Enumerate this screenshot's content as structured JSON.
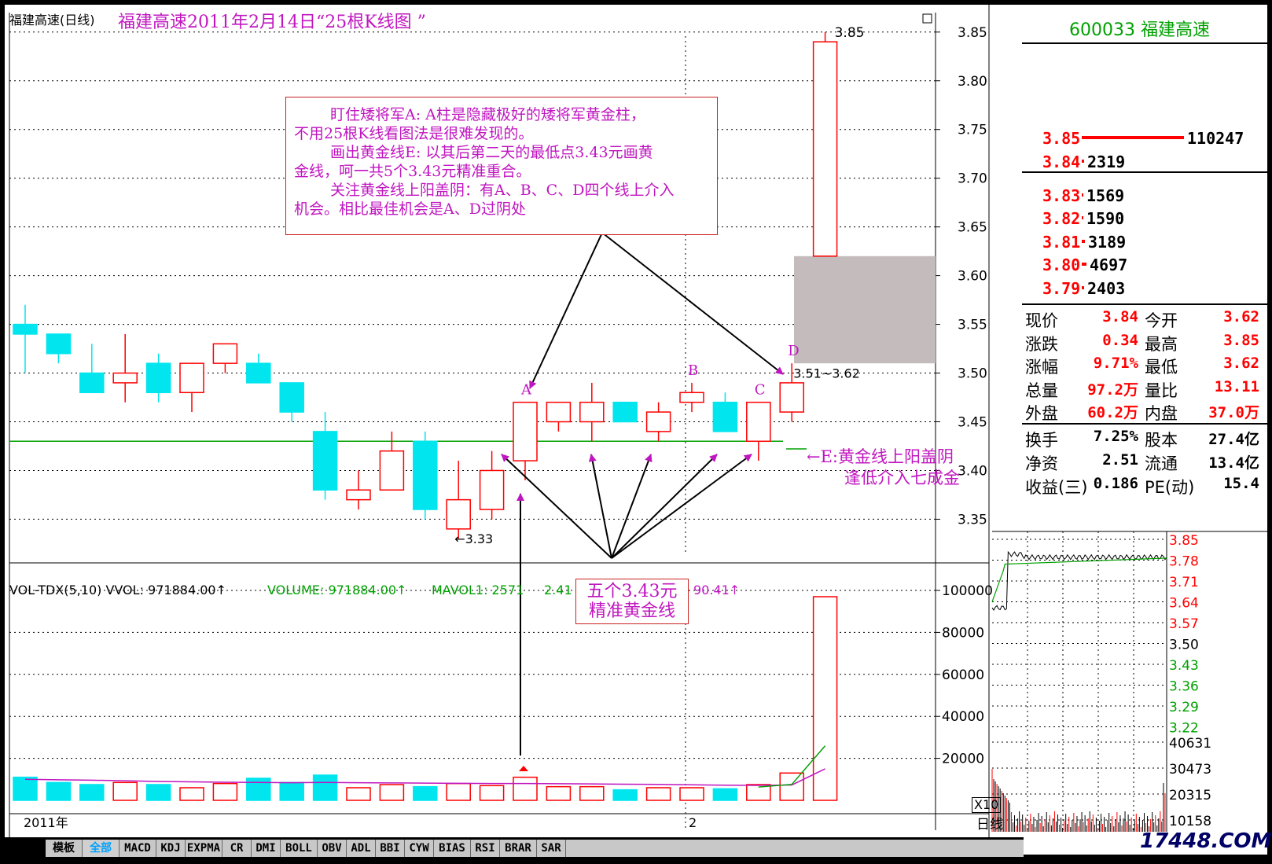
{
  "header": {
    "stock_label": "福建高速(日线)",
    "title": "福建高速2011年2月14日“25根K线图 ”"
  },
  "chart_data": [
    {
      "type": "candlestick",
      "name": "25根K线",
      "ylim": [
        3.31,
        3.87
      ],
      "yticks": [
        "3.85",
        "3.80",
        "3.75",
        "3.70",
        "3.65",
        "3.60",
        "3.55",
        "3.50",
        "3.45",
        "3.40",
        "3.35"
      ],
      "candles": [
        {
          "o": 3.55,
          "c": 3.54,
          "h": 3.57,
          "l": 3.5
        },
        {
          "o": 3.54,
          "c": 3.52,
          "h": 3.54,
          "l": 3.51
        },
        {
          "o": 3.5,
          "c": 3.48,
          "h": 3.53,
          "l": 3.48
        },
        {
          "o": 3.49,
          "c": 3.5,
          "h": 3.54,
          "l": 3.47
        },
        {
          "o": 3.51,
          "c": 3.48,
          "h": 3.52,
          "l": 3.47
        },
        {
          "o": 3.48,
          "c": 3.51,
          "h": 3.51,
          "l": 3.46
        },
        {
          "o": 3.51,
          "c": 3.53,
          "h": 3.53,
          "l": 3.5
        },
        {
          "o": 3.51,
          "c": 3.49,
          "h": 3.52,
          "l": 3.49
        },
        {
          "o": 3.49,
          "c": 3.46,
          "h": 3.49,
          "l": 3.45
        },
        {
          "o": 3.44,
          "c": 3.38,
          "h": 3.46,
          "l": 3.37
        },
        {
          "o": 3.37,
          "c": 3.38,
          "h": 3.4,
          "l": 3.36
        },
        {
          "o": 3.38,
          "c": 3.42,
          "h": 3.44,
          "l": 3.38
        },
        {
          "o": 3.43,
          "c": 3.36,
          "h": 3.44,
          "l": 3.35
        },
        {
          "o": 3.34,
          "c": 3.37,
          "h": 3.41,
          "l": 3.33
        },
        {
          "o": 3.36,
          "c": 3.4,
          "h": 3.42,
          "l": 3.35
        },
        {
          "o": 3.41,
          "c": 3.47,
          "h": 3.47,
          "l": 3.39
        },
        {
          "o": 3.45,
          "c": 3.47,
          "h": 3.47,
          "l": 3.44
        },
        {
          "o": 3.45,
          "c": 3.47,
          "h": 3.49,
          "l": 3.43
        },
        {
          "o": 3.47,
          "c": 3.45,
          "h": 3.47,
          "l": 3.45
        },
        {
          "o": 3.44,
          "c": 3.46,
          "h": 3.47,
          "l": 3.43
        },
        {
          "o": 3.47,
          "c": 3.48,
          "h": 3.49,
          "l": 3.46
        },
        {
          "o": 3.47,
          "c": 3.44,
          "h": 3.48,
          "l": 3.44
        },
        {
          "o": 3.43,
          "c": 3.47,
          "h": 3.47,
          "l": 3.41
        },
        {
          "o": 3.46,
          "c": 3.49,
          "h": 3.51,
          "l": 3.45
        },
        {
          "o": 3.62,
          "c": 3.84,
          "h": 3.85,
          "l": 3.62
        }
      ],
      "points": {
        "A": 15,
        "B": 20,
        "C": 22,
        "D": 23
      },
      "golden_line": 3.43,
      "high_label": "3.85",
      "low_label": "←3.33",
      "range_label": "3.51~3.62",
      "gap_range": [
        3.51,
        3.62
      ],
      "golden_label_1": "←E:黄金线上阳盖阴",
      "golden_label_2": "逢低介入七成金"
    },
    {
      "type": "bar",
      "name": "VOL-TDX(5,10)",
      "ylim": [
        0,
        100000
      ],
      "yticks": [
        "100000",
        "80000",
        "60000",
        "40000",
        "20000"
      ],
      "values": [
        11000,
        8500,
        7500,
        8500,
        7500,
        6000,
        8000,
        10500,
        8500,
        12000,
        6000,
        7500,
        6500,
        8000,
        7000,
        11000,
        6500,
        6500,
        5000,
        6000,
        6000,
        5500,
        7500,
        13000,
        97000
      ],
      "ma5": [
        10500,
        10000,
        9500,
        9000,
        8800,
        8200,
        8000,
        8100,
        8200,
        8800,
        9000,
        8800,
        8500,
        8200,
        7800,
        8000,
        7900,
        7800,
        7300,
        7000,
        6500,
        6000,
        6300,
        7600,
        26000
      ],
      "ma10": [
        10000,
        9800,
        9600,
        9300,
        9000,
        8800,
        8600,
        8500,
        8400,
        8500,
        8400,
        8300,
        8200,
        8100,
        8000,
        8000,
        7900,
        7800,
        7700,
        7600,
        7400,
        7200,
        7100,
        7300,
        15000
      ],
      "x_axis_labels": [
        "2011年",
        "2"
      ],
      "multiplier": "X10"
    }
  ],
  "annotation": {
    "lines": [
      "盯住矮将军A:  A柱是隐藏极好的矮将军黄金柱，",
      "不用25根K线看图法是很难发现的。",
      "画出黄金线E: 以其后第二天的最低点3.43元画黄",
      "金线，呵一共5个3.43元精准重合。",
      "关注黄金线上阳盖阴：有A、B、C、D四个线上介入",
      "机会。相比最佳机会是A、D过阴处"
    ],
    "gold_box": [
      "五个3.43元",
      "精准黄金线"
    ]
  },
  "indicator_bar": {
    "label": "VOL-TDX(5,10) VVOL: 971884.00↑",
    "volume": "VOLUME: 971884.00↑",
    "mavol1": "MAVOL1: 2571",
    "mavol1_tail": "2.41",
    "mavol2_tail": "90.41↑"
  },
  "quote": {
    "code_name": "600033 福建高速",
    "asks": [
      {
        "price": "3.85",
        "vol": "110247"
      },
      {
        "price": "3.84",
        "vol": "2319"
      }
    ],
    "bids": [
      {
        "price": "3.83",
        "vol": "1569"
      },
      {
        "price": "3.82",
        "vol": "1590"
      },
      {
        "price": "3.81",
        "vol": "3189"
      },
      {
        "price": "3.80",
        "vol": "4697"
      },
      {
        "price": "3.79",
        "vol": "2403"
      }
    ],
    "stats": [
      {
        "k1": "现价",
        "v1": "3.84",
        "k2": "今开",
        "v2": "3.62"
      },
      {
        "k1": "涨跌",
        "v1": "0.34",
        "k2": "最高",
        "v2": "3.85"
      },
      {
        "k1": "涨幅",
        "v1": "9.71%",
        "k2": "最低",
        "v2": "3.62"
      },
      {
        "k1": "总量",
        "v1": "97.2万",
        "k2": "量比",
        "v2": "13.11"
      },
      {
        "k1": "外盘",
        "v1": "60.2万",
        "k2": "内盘",
        "v2": "37.0万"
      }
    ],
    "stats2": [
      {
        "k1": "换手",
        "v1": "7.25%",
        "k2": "股本",
        "v2": "27.4亿"
      },
      {
        "k1": "净资",
        "v1": "2.51",
        "k2": "流通",
        "v2": "13.4亿"
      },
      {
        "k1": "收益(三)",
        "v1": "0.186",
        "k2": "PE(动)",
        "v2": "15.4"
      }
    ],
    "intraday_price_ticks": [
      "3.85",
      "3.78",
      "3.71",
      "3.64",
      "3.57",
      "3.50",
      "3.43",
      "3.36",
      "3.29",
      "3.22"
    ],
    "intraday_vol_ticks": [
      "40631",
      "30473",
      "20315",
      "10158"
    ],
    "period_label": "日线",
    "watermark": "17448.COM"
  },
  "tabs": [
    "模板",
    "全部",
    "MACD",
    "KDJ",
    "EXPMA",
    "CR",
    "DMI",
    "BOLL",
    "OBV",
    "ADL",
    "BBI",
    "CYW",
    "BIAS",
    "RSI",
    "BRAR",
    "SAR"
  ],
  "colors": {
    "up": "#ff0000",
    "down": "#00e5ee",
    "gold": "#00a000",
    "magenta": "#c016c0",
    "navy": "#000066"
  }
}
